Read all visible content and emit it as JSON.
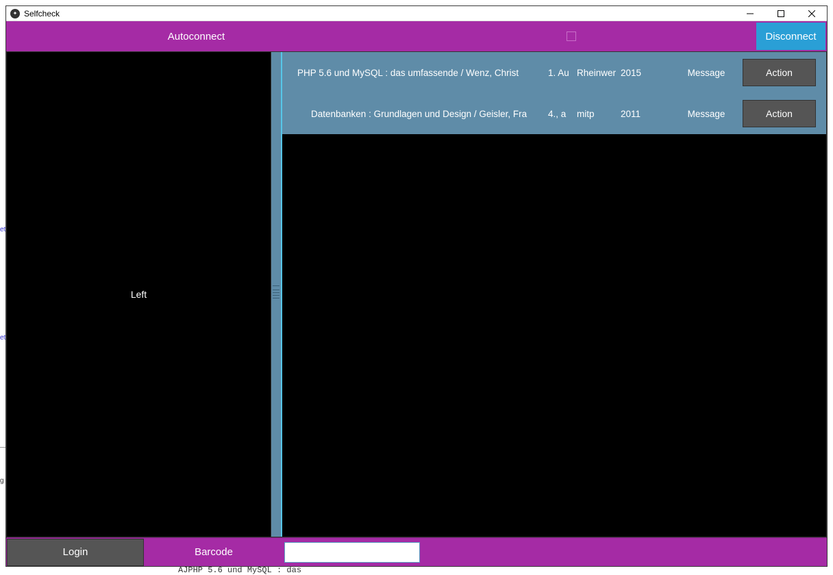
{
  "window": {
    "title": "Selfcheck"
  },
  "toolbar": {
    "autoconnect_label": "Autoconnect",
    "disconnect_label": "Disconnect"
  },
  "left_panel": {
    "label": "Left"
  },
  "items": [
    {
      "title": "PHP 5.6 und MySQL : das umfassende  / Wenz, Christ",
      "edition": "1. Au",
      "publisher": "Rheinwer",
      "year": "2015",
      "message": "Message",
      "action": "Action"
    },
    {
      "title": "Datenbanken : Grundlagen und Design / Geisler, Fra",
      "edition": "4., a",
      "publisher": "mitp",
      "year": "2011",
      "message": "Message",
      "action": "Action"
    }
  ],
  "footer": {
    "login_label": "Login",
    "barcode_label": "Barcode",
    "input_value": ""
  },
  "background": {
    "frag1": "et",
    "frag2": "et",
    "frag3": "g",
    "frag4": "AJPHP 5.6 und MySQL : das"
  }
}
